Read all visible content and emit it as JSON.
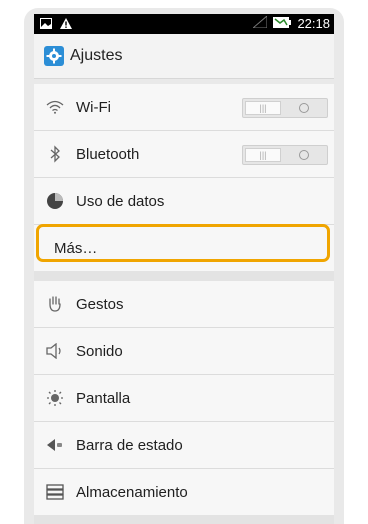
{
  "statusbar": {
    "time": "22:18"
  },
  "actionbar": {
    "title": "Ajustes"
  },
  "settings": {
    "group1": [
      {
        "label": "Wi-Fi",
        "icon": "wifi-icon",
        "toggle": "off"
      },
      {
        "label": "Bluetooth",
        "icon": "bluetooth-icon",
        "toggle": "off"
      },
      {
        "label": "Uso de datos",
        "icon": "data-usage-icon"
      },
      {
        "label": "Más…"
      }
    ],
    "group2": [
      {
        "label": "Gestos",
        "icon": "gesture-hand-icon"
      },
      {
        "label": "Sonido",
        "icon": "speaker-icon"
      },
      {
        "label": "Pantalla",
        "icon": "brightness-icon"
      },
      {
        "label": "Barra de estado",
        "icon": "status-bar-icon"
      },
      {
        "label": "Almacenamiento",
        "icon": "storage-icon"
      }
    ]
  },
  "colors": {
    "highlight": "#f0a500",
    "accent": "#2c8ed6"
  }
}
